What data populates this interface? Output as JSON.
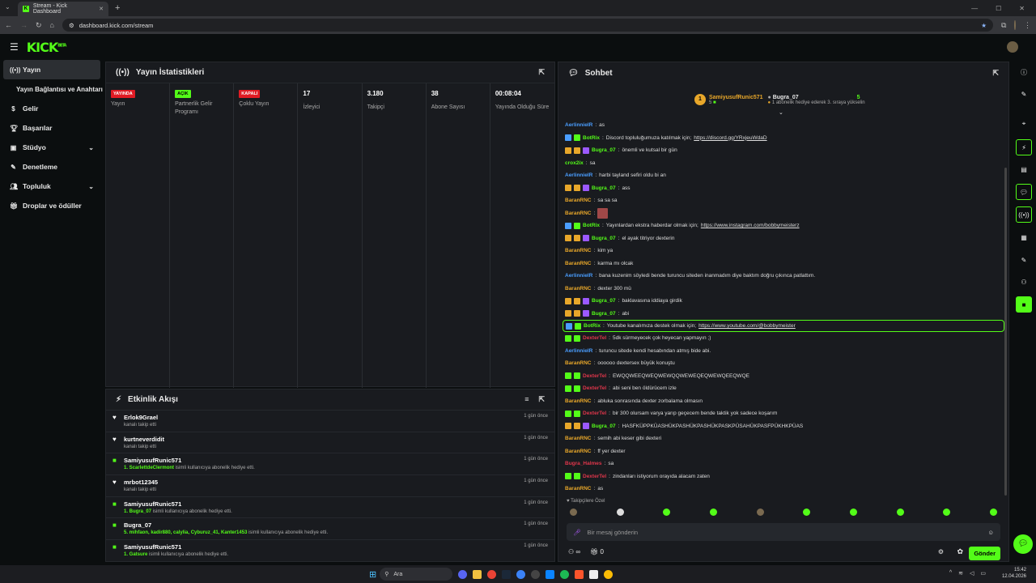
{
  "browser": {
    "tab_title": "Stream - Kick Dashboard",
    "url": "dashboard.kick.com/stream"
  },
  "brand": {
    "logo": "KICK",
    "tm": "BETA",
    "accent": "#53fc18"
  },
  "sidebar": {
    "items": [
      {
        "label": "Yayın",
        "icon": "stream-icon"
      },
      {
        "label": "Yayın Bağlantısı ve Anahtarı",
        "icon": ""
      },
      {
        "label": "Gelir",
        "icon": "dollar-icon"
      },
      {
        "label": "Başarılar",
        "icon": "trophy-icon"
      },
      {
        "label": "Stüdyo",
        "icon": "studio-icon"
      },
      {
        "label": "Denetleme",
        "icon": "wrench-icon"
      },
      {
        "label": "Topluluk",
        "icon": "users-icon"
      },
      {
        "label": "Droplar ve ödüller",
        "icon": "gift-icon"
      }
    ]
  },
  "stats": {
    "title": "Yayın İstatistikleri",
    "cols": [
      {
        "badge": "YAYINDA",
        "label": "Yayın"
      },
      {
        "badge": "AÇIK",
        "label": "Partnerlik Gelir Programı"
      },
      {
        "badge": "KAPALI",
        "label": "Çoklu Yayın"
      },
      {
        "value": "17",
        "label": "İzleyici"
      },
      {
        "value": "3.180",
        "label": "Takipçi"
      },
      {
        "value": "38",
        "label": "Abone Sayısı"
      },
      {
        "value": "00:08:04",
        "label": "Yayında Olduğu Süre"
      }
    ]
  },
  "activity": {
    "title": "Etkinlik Akışı",
    "items": [
      {
        "name": "Erlok9Grael",
        "desc": "kanalı takip etti",
        "hl": "",
        "time": "1 gün önce",
        "kind": "follow"
      },
      {
        "name": "kurtneverdidit",
        "desc": "kanalı takip etti",
        "hl": "",
        "time": "1 gün önce",
        "kind": "follow"
      },
      {
        "name": "SamiyusufRunic571",
        "hl": "1. ScarlettdeClermont",
        "desc": " isimli kullanıcıya abonelik hediye etti.",
        "time": "1 gün önce",
        "kind": "gift"
      },
      {
        "name": "mrbot12345",
        "desc": "kanalı takip etti",
        "hl": "",
        "time": "1 gün önce",
        "kind": "follow"
      },
      {
        "name": "SamiyusufRunic571",
        "hl": "1. Bugra_07",
        "desc": " isimli kullanıcıya abonelik hediye etti.",
        "time": "1 gün önce",
        "kind": "gift"
      },
      {
        "name": "Bugra_07",
        "hl": "5. mihfaon, kadir880, calylia, Cyburuz_41, Kanter1453",
        "desc": " isimli kullanıcıya abonelik hediye etti.",
        "time": "1 gün önce",
        "kind": "gift"
      },
      {
        "name": "SamiyusufRunic571",
        "hl": "1. Gatsure",
        "desc": " isimli kullanıcıya abonelik hediye etti.",
        "time": "1 gün önce",
        "kind": "gift"
      }
    ]
  },
  "chat": {
    "title": "Sohbet",
    "pinned": {
      "rank": "1",
      "user": "SamiyusufRunic571",
      "count": "5",
      "target": "Bugra_07",
      "target_count": "5",
      "desc": "1 abonelik hediye ederek 3. sıraya yükselin"
    },
    "messages": [
      {
        "user": "AerlinnielR",
        "color": "#4a9eff",
        "text": "as",
        "badges": []
      },
      {
        "user": "BotRix",
        "color": "#53fc18",
        "text": "Discord topluluğumuza katılmak için; ",
        "link": "https://discord.gg/YRxjeuWdaD",
        "badges": [
          "#4a9eff",
          "#53fc18"
        ]
      },
      {
        "user": "Bugra_07",
        "color": "#53fc18",
        "text": "önemli ve kutsal bir gün",
        "badges": [
          "#e8a72a",
          "#e8a72a",
          "#9b59ff"
        ]
      },
      {
        "user": "crox2ix",
        "color": "#53fc18",
        "text": "sa",
        "badges": []
      },
      {
        "user": "AerlinnielR",
        "color": "#4a9eff",
        "text": "harbi tayland sefiri oldu bi an",
        "badges": []
      },
      {
        "user": "Bugra_07",
        "color": "#53fc18",
        "text": "ass",
        "badges": [
          "#e8a72a",
          "#e8a72a",
          "#9b59ff"
        ]
      },
      {
        "user": "BaranRNC",
        "color": "#e8a72a",
        "text": "sa sa sa",
        "badges": []
      },
      {
        "user": "BaranRNC",
        "color": "#e8a72a",
        "text": "",
        "emote": true,
        "badges": []
      },
      {
        "user": "BotRix",
        "color": "#53fc18",
        "text": "Yayınlardan ekstra haberdar olmak için; ",
        "link": "https://www.instagram.com/bobbymeisterz",
        "badges": [
          "#4a9eff",
          "#53fc18"
        ]
      },
      {
        "user": "Bugra_07",
        "color": "#53fc18",
        "text": "el ayak titriyor dexterin",
        "badges": [
          "#e8a72a",
          "#e8a72a",
          "#9b59ff"
        ]
      },
      {
        "user": "BaranRNC",
        "color": "#e8a72a",
        "text": "kim ya",
        "badges": []
      },
      {
        "user": "BaranRNC",
        "color": "#e8a72a",
        "text": "karma mı olcak",
        "badges": []
      },
      {
        "user": "AerlinnielR",
        "color": "#4a9eff",
        "text": "bana kuzenim söyledi bende turuncu siteden inanmadım diye baktım doğru çıkınca patlattım.",
        "badges": []
      },
      {
        "user": "BaranRNC",
        "color": "#e8a72a",
        "text": "dexter 300 mü",
        "badges": []
      },
      {
        "user": "Bugra_07",
        "color": "#53fc18",
        "text": "baklavasına iddiaya girdik",
        "badges": [
          "#e8a72a",
          "#e8a72a",
          "#9b59ff"
        ]
      },
      {
        "user": "Bugra_07",
        "color": "#53fc18",
        "text": "abi",
        "badges": [
          "#e8a72a",
          "#e8a72a",
          "#9b59ff"
        ]
      },
      {
        "user": "BotRix",
        "color": "#53fc18",
        "text": "Youtube kanalımıza destek olmak için; ",
        "link": "https://www.youtube.com/@bobbymeister",
        "badges": [
          "#4a9eff",
          "#53fc18"
        ],
        "highlight": true
      },
      {
        "user": "DexterTel",
        "color": "#e0364b",
        "text": "5dk sürmeyecek çok heyecan yapmayın ;)",
        "badges": [
          "#53fc18",
          "#53fc18"
        ]
      },
      {
        "user": "AerlinnielR",
        "color": "#4a9eff",
        "text": "turuncu sitede kendi hesabından atmış bide abi.",
        "badges": []
      },
      {
        "user": "BaranRNC",
        "color": "#e8a72a",
        "text": "oooooo dextersex büyük konuştu",
        "badges": []
      },
      {
        "user": "DexterTel",
        "color": "#e0364b",
        "text": "EWQQWEEQWEQWEWQQWEWEQEQWEWQEEQWQE",
        "badges": [
          "#53fc18",
          "#53fc18"
        ]
      },
      {
        "user": "DexterTel",
        "color": "#e0364b",
        "text": "abi seni ben öldürücem izle",
        "badges": [
          "#53fc18",
          "#53fc18"
        ]
      },
      {
        "user": "BaranRNC",
        "color": "#e8a72a",
        "text": "abluka sonrasında dexter zorbalama olmasın",
        "badges": []
      },
      {
        "user": "DexterTel",
        "color": "#e0364b",
        "text": "bir 300 olursam varya yarıp geçecem bende taktik yok sadece koşarım",
        "badges": [
          "#53fc18",
          "#53fc18"
        ]
      },
      {
        "user": "Bugra_07",
        "color": "#53fc18",
        "text": "HASFKÜPPKÜASHÜKPASHÜKPASHÜKPASKPÜSAHÜKPASFPÜKHKPÜAS",
        "badges": [
          "#e8a72a",
          "#e8a72a",
          "#9b59ff"
        ]
      },
      {
        "user": "BaranRNC",
        "color": "#e8a72a",
        "text": "semih abi keser gibi dexteri",
        "badges": []
      },
      {
        "user": "BaranRNC",
        "color": "#e8a72a",
        "text": "ff yer dexter",
        "badges": []
      },
      {
        "user": "Bugra_Halmes",
        "color": "#e0364b",
        "text": "sa",
        "badges": []
      },
      {
        "user": "DexterTel",
        "color": "#e0364b",
        "text": "zindanları istiyorum orayıda alacam zaten",
        "badges": [
          "#53fc18",
          "#53fc18"
        ]
      },
      {
        "user": "BaranRNC",
        "color": "#e8a72a",
        "text": "as",
        "badges": []
      }
    ],
    "follower_only": "Takipçilere Özel",
    "input_placeholder": "Bir mesaj gönderin",
    "send_label": "Gönder",
    "infinity": "∞",
    "gift_count": "0"
  },
  "taskbar": {
    "search": "Ara",
    "time": "15:42",
    "date": "12.04.2026"
  }
}
